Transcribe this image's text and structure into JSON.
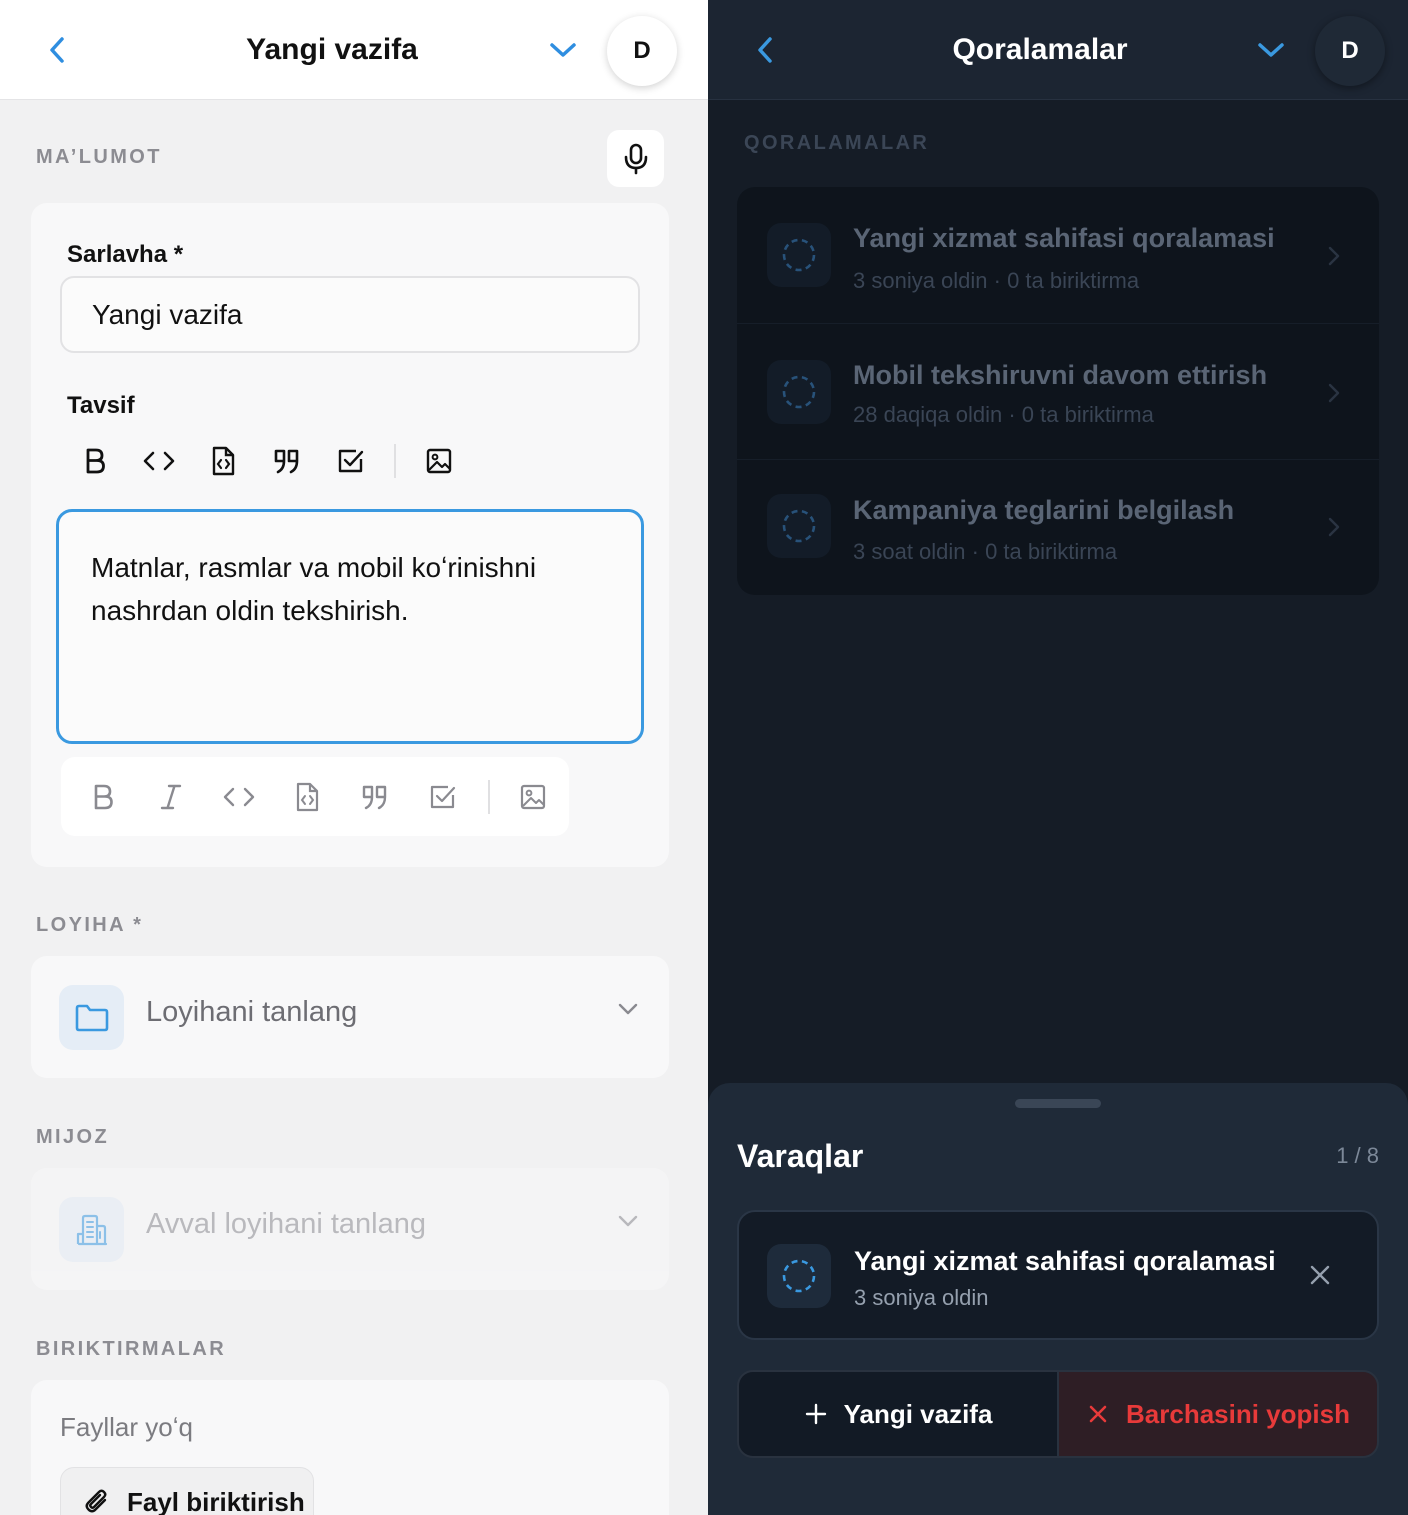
{
  "left": {
    "header": {
      "back_icon": "chevron-left-icon",
      "title": "Yangi vazifa",
      "dropdown_icon": "chevron-down-icon",
      "avatar": "D"
    },
    "info_section": {
      "label": "MA’LUMOT",
      "mic_icon": "microphone-icon"
    },
    "title_field": {
      "label": "Sarlavha *",
      "value": "Yangi vazifa"
    },
    "description": {
      "label": "Tavsif",
      "toolbar_top": [
        "bold-icon",
        "code-icon",
        "code-file-icon",
        "quote-icon",
        "checkbox-icon",
        "image-icon"
      ],
      "value": "Matnlar, rasmlar va mobil koʻrinishni nashrdan oldin tekshirish.",
      "toolbar_bottom": [
        "bold-icon",
        "italic-icon",
        "code-icon",
        "code-file-icon",
        "quote-icon",
        "checkbox-icon",
        "image-icon"
      ]
    },
    "project": {
      "label": "LOYIHA *",
      "placeholder": "Loyihani tanlang",
      "icon": "folder-icon"
    },
    "client": {
      "label": "MIJOZ",
      "placeholder": "Avval loyihani tanlang",
      "icon": "building-icon",
      "disabled": true
    },
    "attachments": {
      "label": "BIRIKTIRMALAR",
      "empty_text": "Fayllar yoʻq",
      "attach_button": "Fayl biriktirish",
      "attach_icon": "paperclip-icon"
    }
  },
  "right": {
    "header": {
      "back_icon": "chevron-left-icon",
      "title": "Qoralamalar",
      "dropdown_icon": "chevron-down-icon",
      "avatar": "D"
    },
    "section_label": "QORALAMALAR",
    "drafts": [
      {
        "title": "Yangi xizmat sahifasi qoralamasi",
        "meta": "3 soniya oldin · 0 ta biriktirma"
      },
      {
        "title": "Mobil tekshiruvni davom ettirish",
        "meta": "28 daqiqa oldin · 0 ta biriktirma"
      },
      {
        "title": "Kampaniya teglarini belgilash",
        "meta": "3 soat oldin · 0 ta biriktirma"
      }
    ],
    "sheet": {
      "title": "Varaqlar",
      "count": "1 / 8",
      "tab": {
        "title": "Yangi xizmat sahifasi qoralamasi",
        "meta": "3 soniya oldin"
      },
      "new_button": "Yangi vazifa",
      "close_all_button": "Barchasini yopish"
    }
  },
  "colors": {
    "accent": "#3a99e0",
    "danger": "#e83a3a",
    "left_bg": "#f1f1f2",
    "right_bg": "#151c26"
  }
}
